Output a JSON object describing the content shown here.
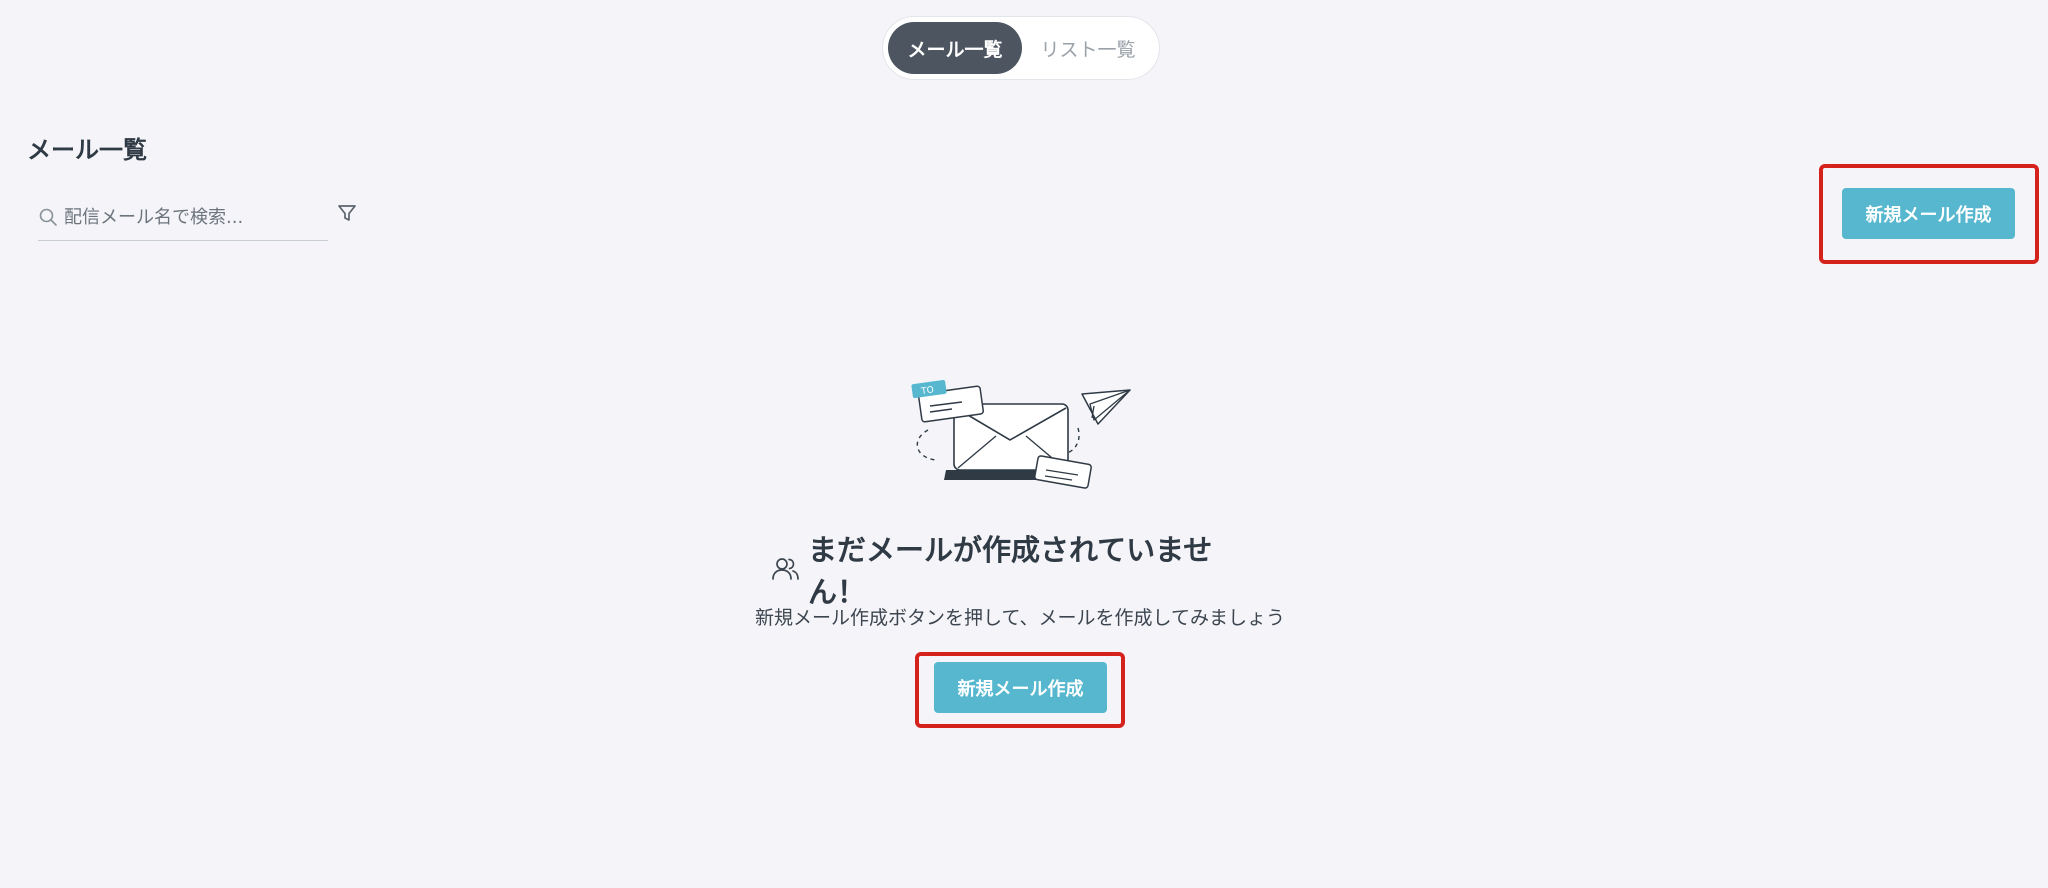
{
  "tabs": {
    "active_label": "メール一覧",
    "inactive_label": "リスト一覧"
  },
  "page": {
    "title": "メール一覧"
  },
  "search": {
    "placeholder": "配信メール名で検索..."
  },
  "toolbar": {
    "create_button_label": "新規メール作成"
  },
  "empty_state": {
    "title": "まだメールが作成されていません！",
    "description": "新規メール作成ボタンを押して、メールを作成してみましょう",
    "button_label": "新規メール作成",
    "illustration_tag": "TO"
  },
  "colors": {
    "background": "#f5f5f9",
    "accent": "#56b7cf",
    "active_tab": "#4d5660",
    "highlight": "#d6221c"
  },
  "icons": {
    "search": "search-icon",
    "filter": "filter-icon",
    "users": "users-icon"
  }
}
